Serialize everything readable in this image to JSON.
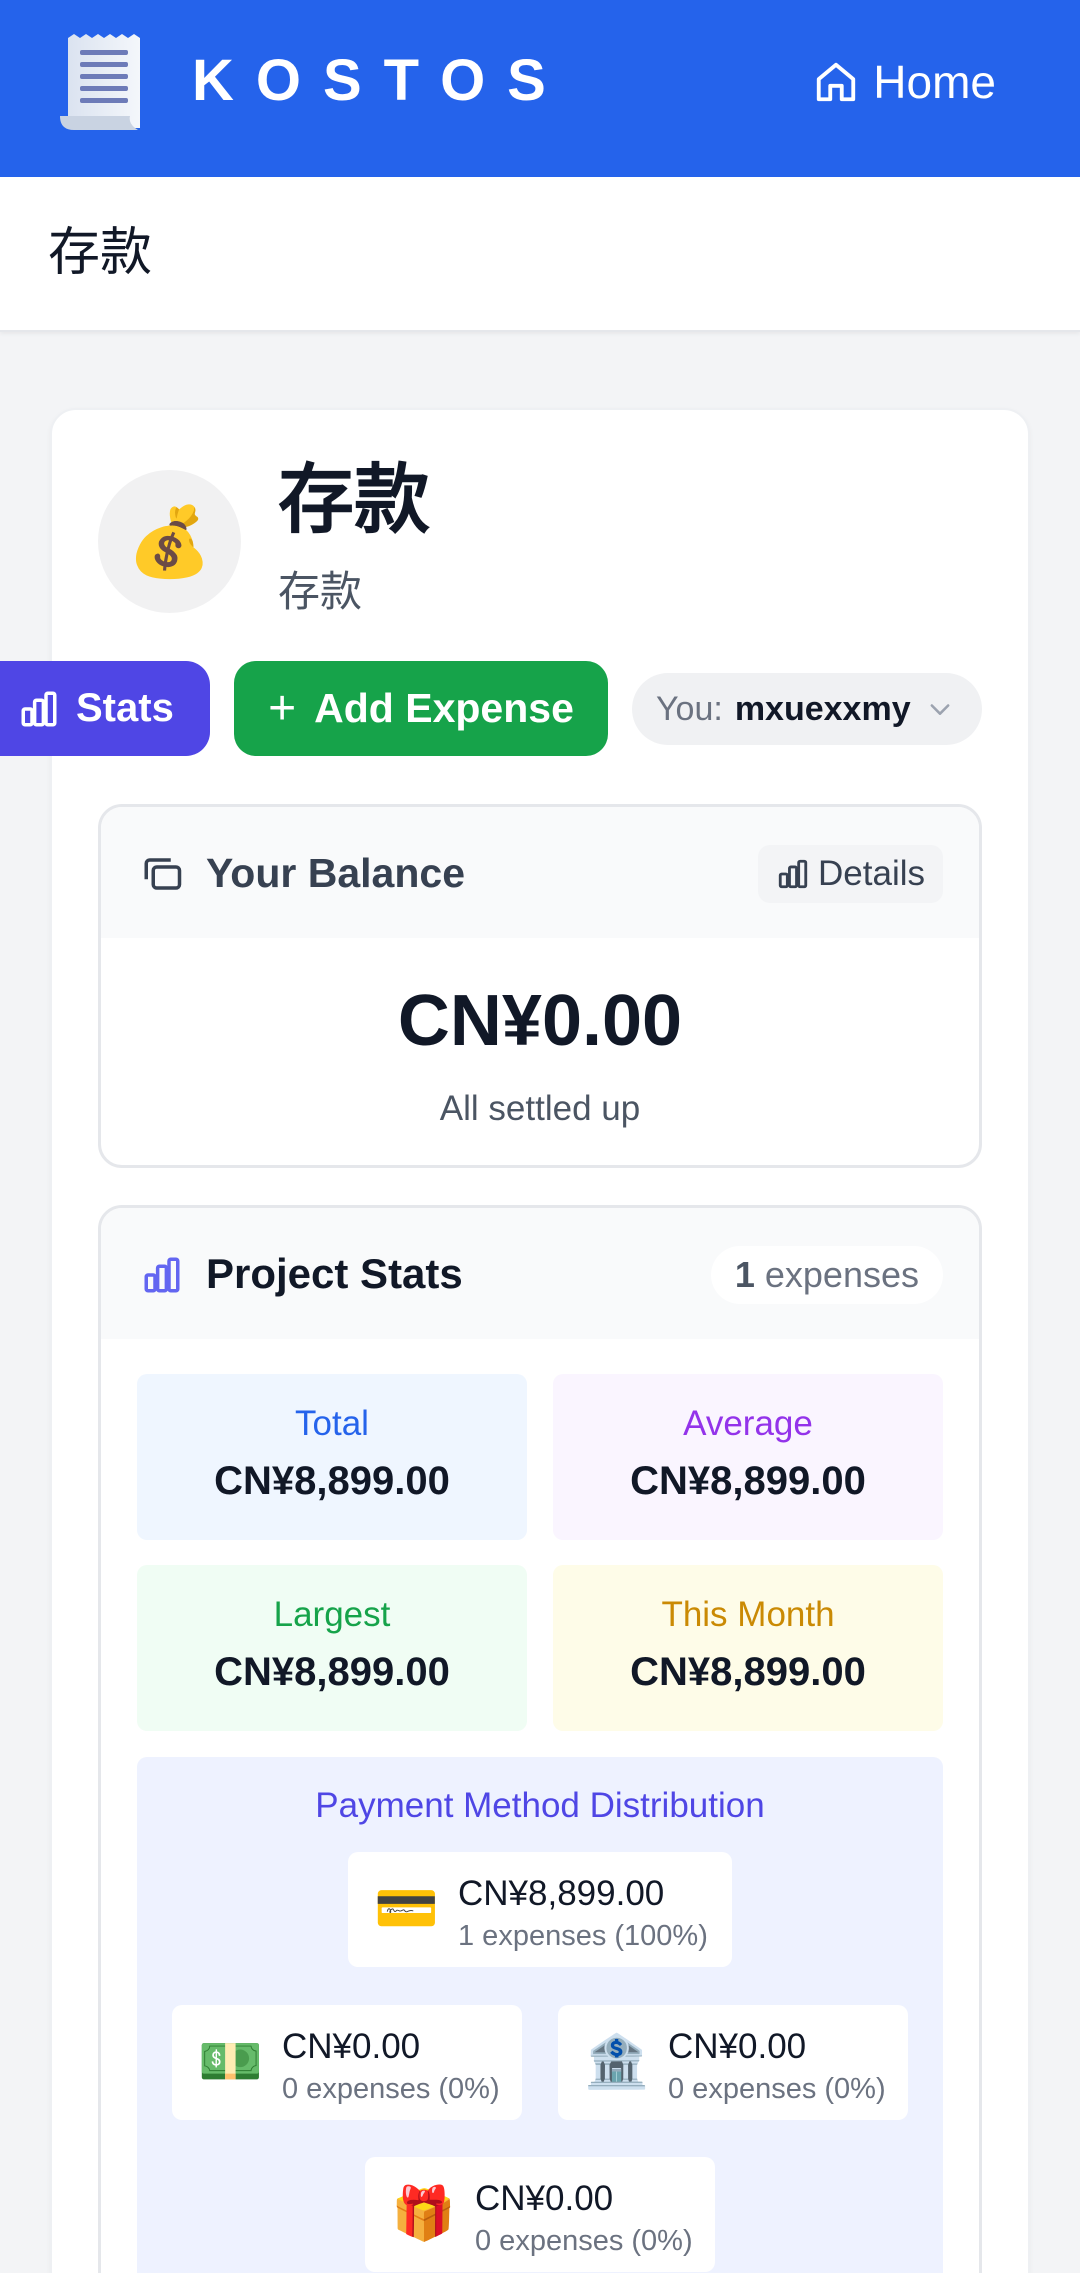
{
  "header": {
    "brand": "KOSTOS",
    "home_label": "Home",
    "logo_icon": "receipt-icon"
  },
  "subheader": {
    "title": "存款"
  },
  "project": {
    "avatar": "💰",
    "name": "存款",
    "description": "存款"
  },
  "actions": {
    "stats_label": "Stats",
    "add_label": "Add Expense",
    "you_label": "You:",
    "you_value": "mxuexxmy"
  },
  "balance": {
    "title": "Your Balance",
    "details_label": "Details",
    "amount": "CN¥0.00",
    "status": "All settled up"
  },
  "stats": {
    "title": "Project Stats",
    "count_number": "1",
    "count_label": "expenses",
    "boxes": [
      {
        "label": "Total",
        "value": "CN¥8,899.00",
        "color": "#2563eb",
        "bg": "#eff6ff"
      },
      {
        "label": "Average",
        "value": "CN¥8,899.00",
        "color": "#9333ea",
        "bg": "#faf5ff"
      },
      {
        "label": "Largest",
        "value": "CN¥8,899.00",
        "color": "#16a34a",
        "bg": "#f0fdf4"
      },
      {
        "label": "This Month",
        "value": "CN¥8,899.00",
        "color": "#ca8a04",
        "bg": "#fefce8"
      }
    ],
    "payment_title": "Payment Method Distribution",
    "payment_methods": [
      {
        "icon": "💳",
        "amount": "CN¥8,899.00",
        "count": "1 expenses (100%)"
      },
      {
        "icon": "💵",
        "amount": "CN¥0.00",
        "count": "0 expenses (0%)"
      },
      {
        "icon": "🏦",
        "amount": "CN¥0.00",
        "count": "0 expenses (0%)"
      },
      {
        "icon": "🎁",
        "amount": "CN¥0.00",
        "count": "0 expenses (0%)"
      }
    ]
  },
  "colors": {
    "brand": "#2563eb",
    "stats_button": "#4f46e5",
    "add_button": "#16a34a"
  }
}
